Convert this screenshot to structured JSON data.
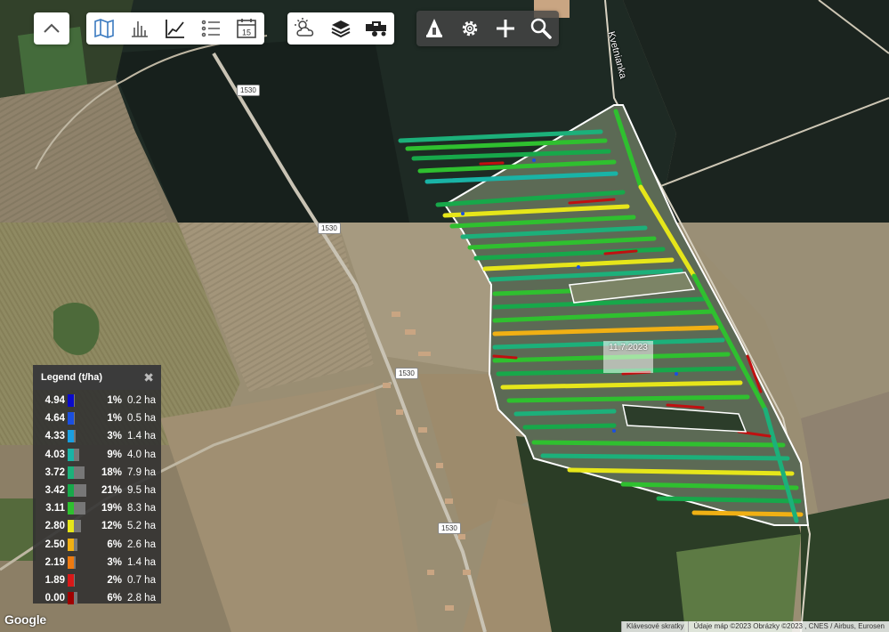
{
  "toolbar_main": {
    "tools": [
      {
        "name": "map-view",
        "icon": "map-icon"
      },
      {
        "name": "bar-chart",
        "icon": "bar-chart-icon"
      },
      {
        "name": "line-chart",
        "icon": "line-chart-icon"
      },
      {
        "name": "list",
        "icon": "list-icon"
      },
      {
        "name": "calendar",
        "icon": "calendar-icon",
        "text": "15"
      }
    ]
  },
  "toolbar_layers": {
    "tools": [
      {
        "name": "weather",
        "icon": "weather-icon"
      },
      {
        "name": "layers",
        "icon": "layers-icon"
      },
      {
        "name": "harvester",
        "icon": "harvester-icon"
      }
    ]
  },
  "toolbar_actions": {
    "tools": [
      {
        "name": "home",
        "icon": "home-icon"
      },
      {
        "name": "settings",
        "icon": "gear-icon"
      },
      {
        "name": "add",
        "icon": "plus-icon"
      },
      {
        "name": "search",
        "icon": "search-icon"
      }
    ]
  },
  "legend": {
    "title": "Legend (t/ha)",
    "rows": [
      {
        "value": "4.94",
        "color": "#0a0acc",
        "pct": "1%",
        "pct_num": 1,
        "area": "0.2 ha"
      },
      {
        "value": "4.64",
        "color": "#1a4fe0",
        "pct": "1%",
        "pct_num": 1,
        "area": "0.5 ha"
      },
      {
        "value": "4.33",
        "color": "#1a9ee0",
        "pct": "3%",
        "pct_num": 3,
        "area": "1.4 ha"
      },
      {
        "value": "4.03",
        "color": "#19b3a6",
        "pct": "9%",
        "pct_num": 9,
        "area": "4.0 ha"
      },
      {
        "value": "3.72",
        "color": "#1cb07a",
        "pct": "18%",
        "pct_num": 18,
        "area": "7.9 ha"
      },
      {
        "value": "3.42",
        "color": "#17a84a",
        "pct": "21%",
        "pct_num": 21,
        "area": "9.5 ha"
      },
      {
        "value": "3.11",
        "color": "#2fc02f",
        "pct": "19%",
        "pct_num": 19,
        "area": "8.3 ha"
      },
      {
        "value": "2.80",
        "color": "#e6e61a",
        "pct": "12%",
        "pct_num": 12,
        "area": "5.2 ha"
      },
      {
        "value": "2.50",
        "color": "#f0b014",
        "pct": "6%",
        "pct_num": 6,
        "area": "2.6 ha"
      },
      {
        "value": "2.19",
        "color": "#ee7a10",
        "pct": "3%",
        "pct_num": 3,
        "area": "1.4 ha"
      },
      {
        "value": "1.89",
        "color": "#d81818",
        "pct": "2%",
        "pct_num": 2,
        "area": "0.7 ha"
      },
      {
        "value": "0.00",
        "color": "#a00000",
        "pct": "6%",
        "pct_num": 6,
        "area": "2.8 ha"
      }
    ]
  },
  "map": {
    "road_label": "1530",
    "street_label": "Kvetnianka",
    "date_label": "11.7.2023",
    "google": "Google",
    "attribution": [
      "Klávesové skratky",
      "Údaje máp ©2023 Obrázky ©2023 , CNES / Airbus, Eurosen"
    ]
  }
}
